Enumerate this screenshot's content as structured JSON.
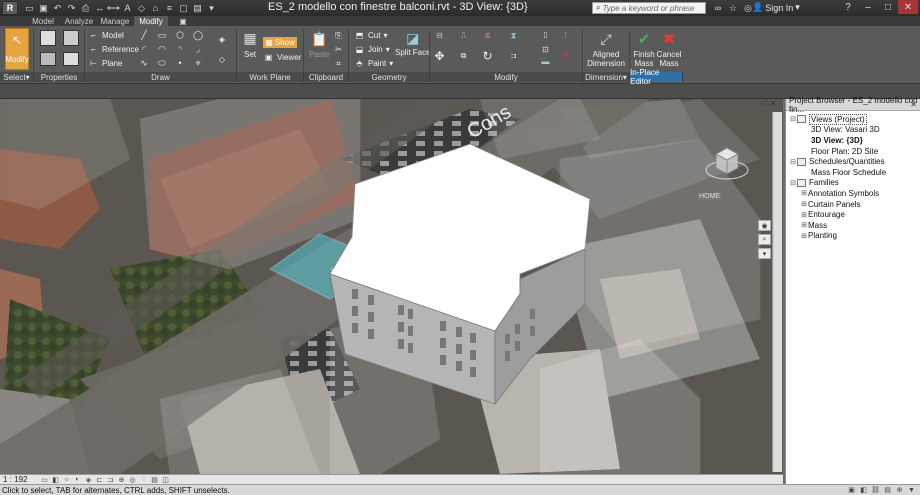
{
  "titlebar": {
    "document_title": "ES_2 modello con finestre balconi.rvt - 3D View: {3D}",
    "search_placeholder": "Type a keyword or phrase",
    "sign_in": "Sign In",
    "app_logo": "R"
  },
  "tabs": [
    {
      "label": "Model"
    },
    {
      "label": "Analyze"
    },
    {
      "label": "Manage"
    },
    {
      "label": "Modify",
      "active": true
    }
  ],
  "ribbon": {
    "modify_label": "Modify",
    "draw_side": {
      "model": "Model",
      "reference": "Reference",
      "plane": "Plane"
    },
    "workplane": {
      "set": "Set",
      "show": "Show",
      "viewer": "Viewer"
    },
    "clipboard": {
      "paste": "Paste"
    },
    "geometry": {
      "cut": "Cut",
      "join": "Join",
      "paint": "Paint",
      "split_face": "Split Face"
    },
    "dimension": {
      "aligned": "Aligned\nDimension"
    },
    "inplace": {
      "finish": "Finish\nMass",
      "cancel": "Cancel\nMass"
    },
    "panels": [
      {
        "label": "Select",
        "dropdown": true
      },
      {
        "label": "Properties"
      },
      {
        "label": "Draw"
      },
      {
        "label": "Work Plane"
      },
      {
        "label": "Clipboard"
      },
      {
        "label": "Geometry"
      },
      {
        "label": "Modify"
      },
      {
        "label": "Dimension",
        "dropdown": true
      },
      {
        "label": "In-Place Editor",
        "highlight": true
      }
    ]
  },
  "viewport": {
    "scale": "1 : 192",
    "road_label": "Cons",
    "viewcube_label": "HOME"
  },
  "project_browser": {
    "title": "Project Browser - ES_2 modello con fin...",
    "nodes": [
      {
        "label": "Views (Project)",
        "level": 0,
        "twisty": "−",
        "icon": true
      },
      {
        "label": "3D View: Vasari 3D",
        "level": 1
      },
      {
        "label": "3D View: {3D}",
        "level": 1,
        "bold": true
      },
      {
        "label": "Floor Plan: 2D Site",
        "level": 1
      },
      {
        "label": "Schedules/Quantities",
        "level": 0,
        "twisty": "−",
        "icon": true
      },
      {
        "label": "Mass Floor Schedule",
        "level": 1
      },
      {
        "label": "Families",
        "level": 0,
        "twisty": "−",
        "icon": true
      },
      {
        "label": "Annotation Symbols",
        "level": 1,
        "twisty": "+"
      },
      {
        "label": "Curtain Panels",
        "level": 1,
        "twisty": "+"
      },
      {
        "label": "Entourage",
        "level": 1,
        "twisty": "+"
      },
      {
        "label": "Mass",
        "level": 1,
        "twisty": "+"
      },
      {
        "label": "Planting",
        "level": 1,
        "twisty": "+"
      }
    ]
  },
  "statusbar": {
    "message": "Click to select, TAB for alternates, CTRL adds, SHIFT unselects."
  },
  "colors": {
    "modify_accent": "#e5a43d",
    "inplace_accent": "#2f6fa8",
    "ribbon_bg": "#5a5a5a",
    "building": "#ffffff",
    "selection_cyan": "#55c7d6"
  }
}
